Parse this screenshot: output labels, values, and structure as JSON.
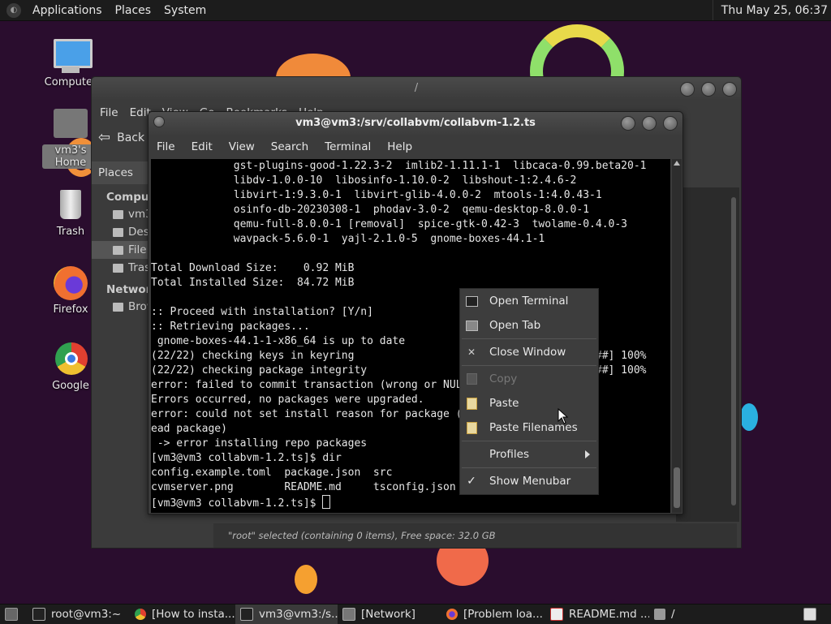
{
  "top_panel": {
    "menus": [
      "Applications",
      "Places",
      "System"
    ],
    "clock": "Thu May 25, 06:37"
  },
  "desktop": {
    "icons": [
      {
        "label": "Computer"
      },
      {
        "label": "vm3's Home"
      },
      {
        "label": "Trash"
      },
      {
        "label": "Firefox"
      },
      {
        "label": "Google"
      }
    ]
  },
  "file_manager": {
    "title": "/",
    "menus": [
      "File",
      "Edit",
      "View",
      "Go",
      "Bookmarks",
      "Help"
    ],
    "back_label": "Back",
    "places_header": "Places",
    "sections": [
      {
        "title": "Computer",
        "items": [
          "vm3",
          "Desktop",
          "File System",
          "Trash"
        ]
      },
      {
        "title": "Network",
        "items": [
          "Browse Network"
        ]
      }
    ],
    "status": "\"root\" selected (containing 0 items), Free space: 32.0 GB"
  },
  "terminal": {
    "title": "vm3@vm3:/srv/collabvm/collabvm-1.2.ts",
    "menus": [
      "File",
      "Edit",
      "View",
      "Search",
      "Terminal",
      "Help"
    ],
    "lines": [
      "             gst-plugins-good-1.22.3-2  imlib2-1.11.1-1  libcaca-0.99.beta20-1",
      "             libdv-1.0.0-10  libosinfo-1.10.0-2  libshout-1:2.4.6-2",
      "             libvirt-1:9.3.0-1  libvirt-glib-4.0.0-2  mtools-1:4.0.43-1",
      "             osinfo-db-20230308-1  phodav-3.0-2  qemu-desktop-8.0.0-1",
      "             qemu-full-8.0.0-1 [removal]  spice-gtk-0.42-3  twolame-0.4.0-3",
      "             wavpack-5.6.0-1  yajl-2.1.0-5  gnome-boxes-44.1-1",
      "",
      "Total Download Size:    0.92 MiB",
      "Total Installed Size:  84.72 MiB",
      "",
      ":: Proceed with installation? [Y/n]",
      ":: Retrieving packages...",
      " gnome-boxes-44.1-1-x86_64 is up to date",
      "(22/22) checking keys in keyring                   [####################] 100%",
      "(22/22) checking package integrity                 [####################] 100%",
      "error: failed to commit transaction (wrong or NULL argument passed)",
      "Errors occurred, no packages were upgraded.",
      "error: could not set install reason for package (could not find or r",
      "ead package)",
      " -> error installing repo packages",
      "[vm3@vm3 collabvm-1.2.ts]$ dir",
      "config.example.toml  package.json  src",
      "cvmserver.png        README.md     tsconfig.json",
      "[vm3@vm3 collabvm-1.2.ts]$ "
    ]
  },
  "context_menu": {
    "items": [
      {
        "label": "Open Terminal",
        "icon": "terminal-icon",
        "enabled": true
      },
      {
        "label": "Open Tab",
        "icon": "new-tab-icon",
        "enabled": true
      },
      {
        "label": "Close Window",
        "icon": "close-icon",
        "enabled": true
      },
      {
        "label": "Copy",
        "icon": "copy-icon",
        "enabled": false
      },
      {
        "label": "Paste",
        "icon": "paste-icon",
        "enabled": true
      },
      {
        "label": "Paste Filenames",
        "icon": "paste-icon",
        "enabled": true
      },
      {
        "label": "Profiles",
        "icon": "",
        "enabled": true,
        "submenu": true
      },
      {
        "label": "Show Menubar",
        "icon": "check-icon",
        "enabled": true,
        "checked": true
      }
    ]
  },
  "taskbar": {
    "items": [
      {
        "label": "root@vm3:~",
        "active": false
      },
      {
        "label": "[How to insta...",
        "active": false
      },
      {
        "label": "vm3@vm3:/s...",
        "active": true
      },
      {
        "label": "[Network]",
        "active": false
      },
      {
        "label": "[Problem loa...",
        "active": false
      },
      {
        "label": "README.md ...",
        "active": false
      },
      {
        "label": "/",
        "active": false
      }
    ]
  }
}
